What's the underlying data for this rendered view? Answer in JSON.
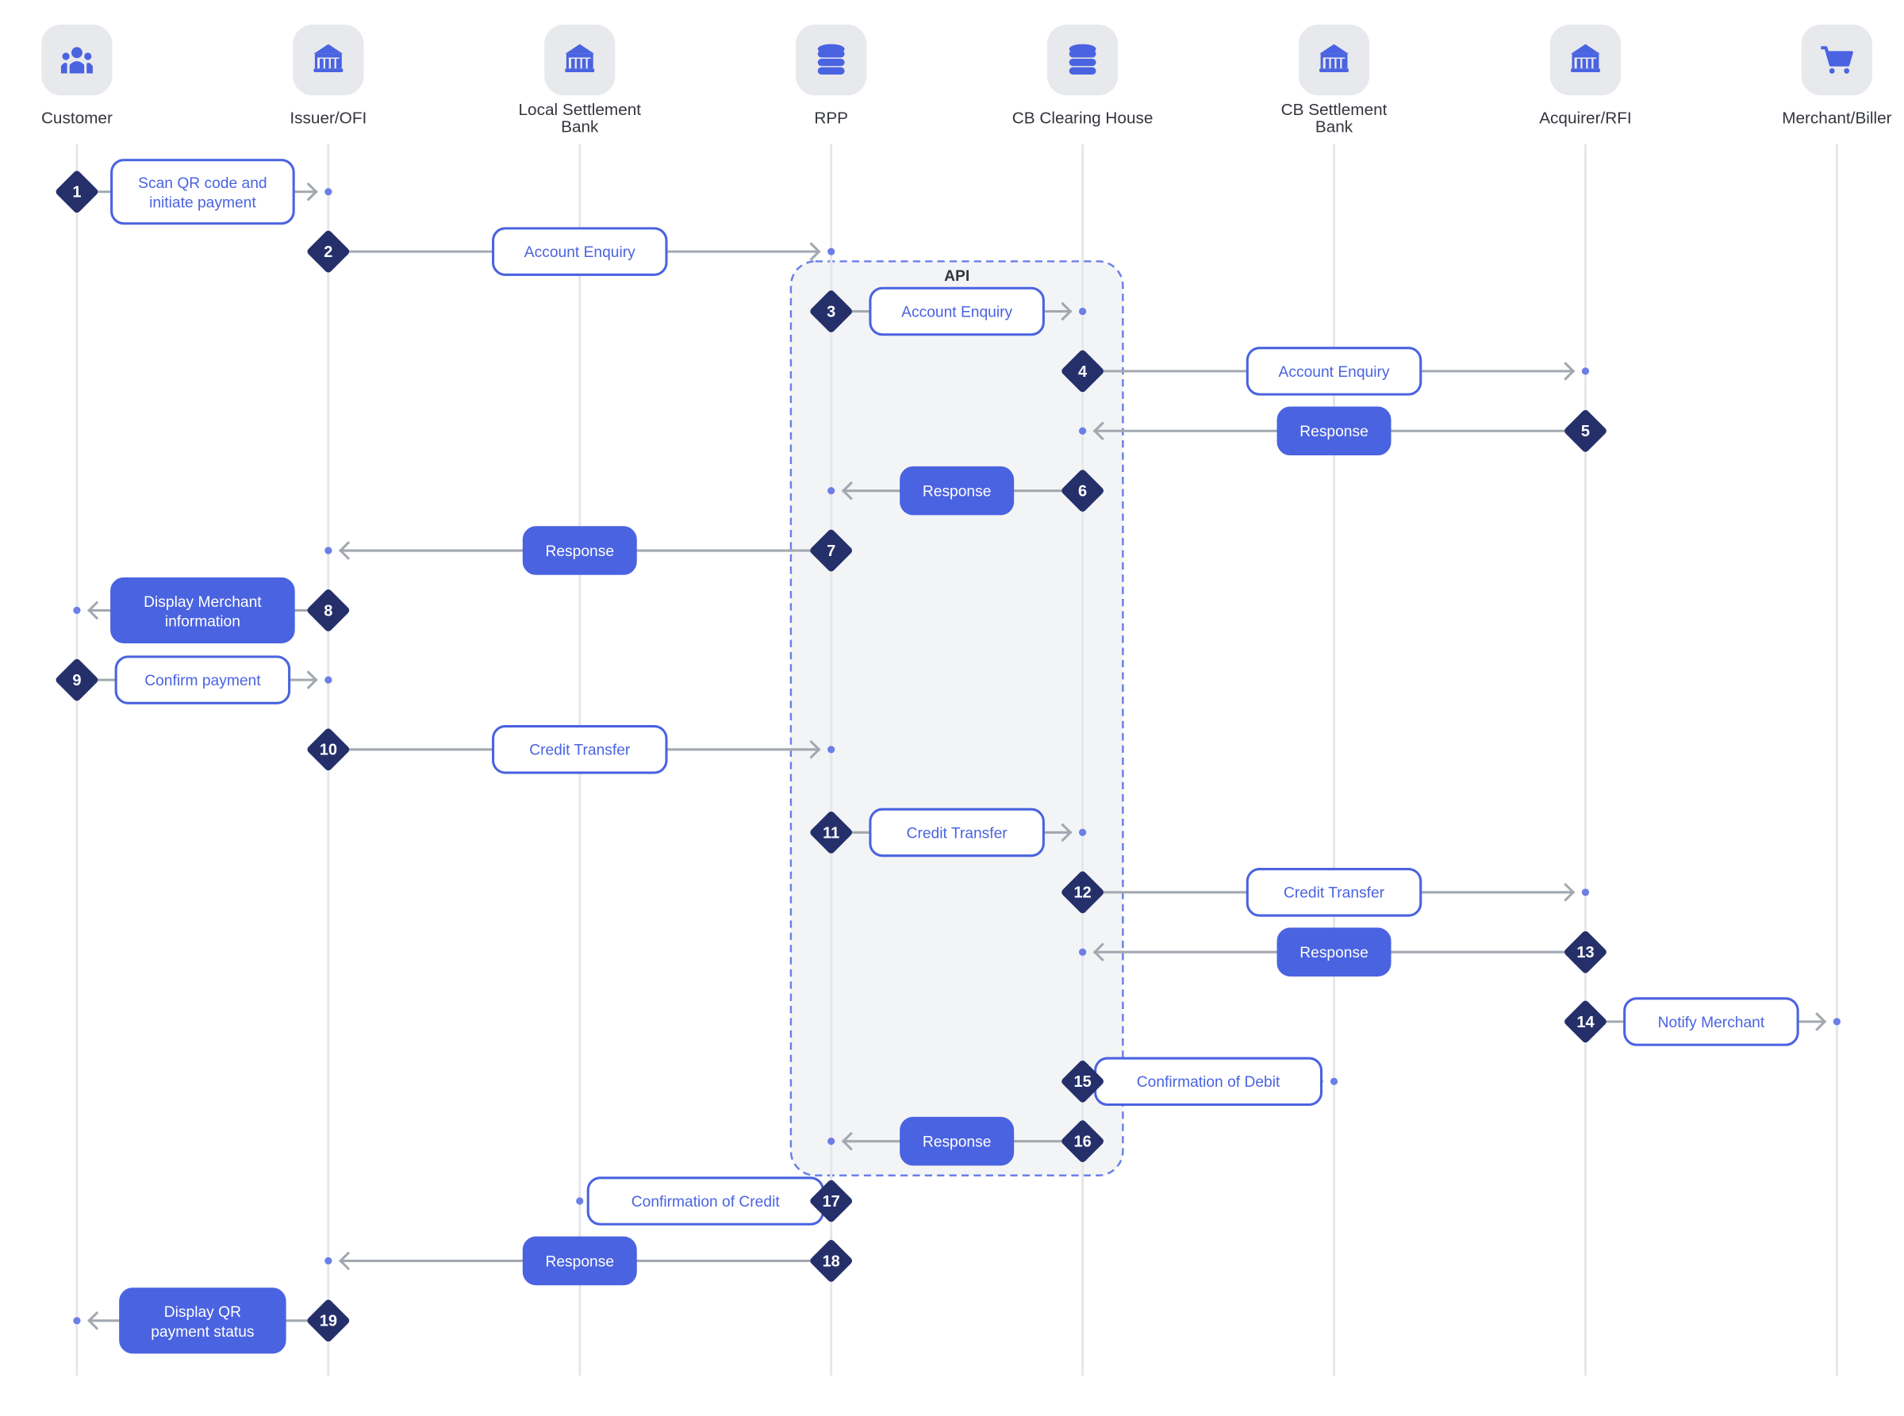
{
  "colors": {
    "accent": "#4a63e0",
    "navy": "#25306b",
    "connector": "#a3a8b0",
    "lane": "#e6e7ea",
    "tile": "#e8e9ed",
    "api_fill": "#f3f4f6",
    "api_border": "#6b7fe8",
    "dot": "#6b7fe8"
  },
  "lanes": [
    {
      "label": [
        "Customer"
      ],
      "icon": "people-icon"
    },
    {
      "label": [
        "Issuer/OFI"
      ],
      "icon": "bank-icon"
    },
    {
      "label": [
        "Local Settlement",
        "Bank"
      ],
      "icon": "bank-icon"
    },
    {
      "label": [
        "RPP"
      ],
      "icon": "database-icon"
    },
    {
      "label": [
        "CB Clearing House"
      ],
      "icon": "database-icon"
    },
    {
      "label": [
        "CB Settlement",
        "Bank"
      ],
      "icon": "bank-icon"
    },
    {
      "label": [
        "Acquirer/RFI"
      ],
      "icon": "bank-icon"
    },
    {
      "label": [
        "Merchant/Biller"
      ],
      "icon": "cart-icon"
    }
  ],
  "api_group": {
    "label": "API"
  },
  "steps": [
    {
      "n": "1",
      "from": 0,
      "to": 1,
      "label": [
        "Scan QR code and",
        "initiate payment"
      ],
      "style": "outline"
    },
    {
      "n": "2",
      "from": 1,
      "to": 3,
      "label": [
        "Account Enquiry"
      ],
      "style": "outline"
    },
    {
      "n": "3",
      "from": 3,
      "to": 4,
      "label": [
        "Account Enquiry"
      ],
      "style": "outline"
    },
    {
      "n": "4",
      "from": 4,
      "to": 6,
      "label": [
        "Account Enquiry"
      ],
      "style": "outline"
    },
    {
      "n": "5",
      "from": 6,
      "to": 4,
      "label": [
        "Response"
      ],
      "style": "filled"
    },
    {
      "n": "6",
      "from": 4,
      "to": 3,
      "label": [
        "Response"
      ],
      "style": "filled"
    },
    {
      "n": "7",
      "from": 3,
      "to": 1,
      "label": [
        "Response"
      ],
      "style": "filled"
    },
    {
      "n": "8",
      "from": 1,
      "to": 0,
      "label": [
        "Display Merchant",
        "information"
      ],
      "style": "filled"
    },
    {
      "n": "9",
      "from": 0,
      "to": 1,
      "label": [
        "Confirm payment"
      ],
      "style": "outline"
    },
    {
      "n": "10",
      "from": 1,
      "to": 3,
      "label": [
        "Credit Transfer"
      ],
      "style": "outline"
    },
    {
      "n": "11",
      "from": 3,
      "to": 4,
      "label": [
        "Credit Transfer"
      ],
      "style": "outline"
    },
    {
      "n": "12",
      "from": 4,
      "to": 6,
      "label": [
        "Credit Transfer"
      ],
      "style": "outline"
    },
    {
      "n": "13",
      "from": 6,
      "to": 4,
      "label": [
        "Response"
      ],
      "style": "filled"
    },
    {
      "n": "14",
      "from": 6,
      "to": 7,
      "label": [
        "Notify Merchant"
      ],
      "style": "outline"
    },
    {
      "n": "15",
      "from": 4,
      "to": 5,
      "label": [
        "Confirmation of Debit"
      ],
      "style": "outline"
    },
    {
      "n": "16",
      "from": 4,
      "to": 3,
      "label": [
        "Response"
      ],
      "style": "filled"
    },
    {
      "n": "17",
      "from": 3,
      "to": 2,
      "label": [
        "Confirmation of Credit"
      ],
      "style": "outline"
    },
    {
      "n": "18",
      "from": 3,
      "to": 1,
      "label": [
        "Response"
      ],
      "style": "filled"
    },
    {
      "n": "19",
      "from": 1,
      "to": 0,
      "label": [
        "Display QR",
        "payment status"
      ],
      "style": "filled"
    }
  ]
}
